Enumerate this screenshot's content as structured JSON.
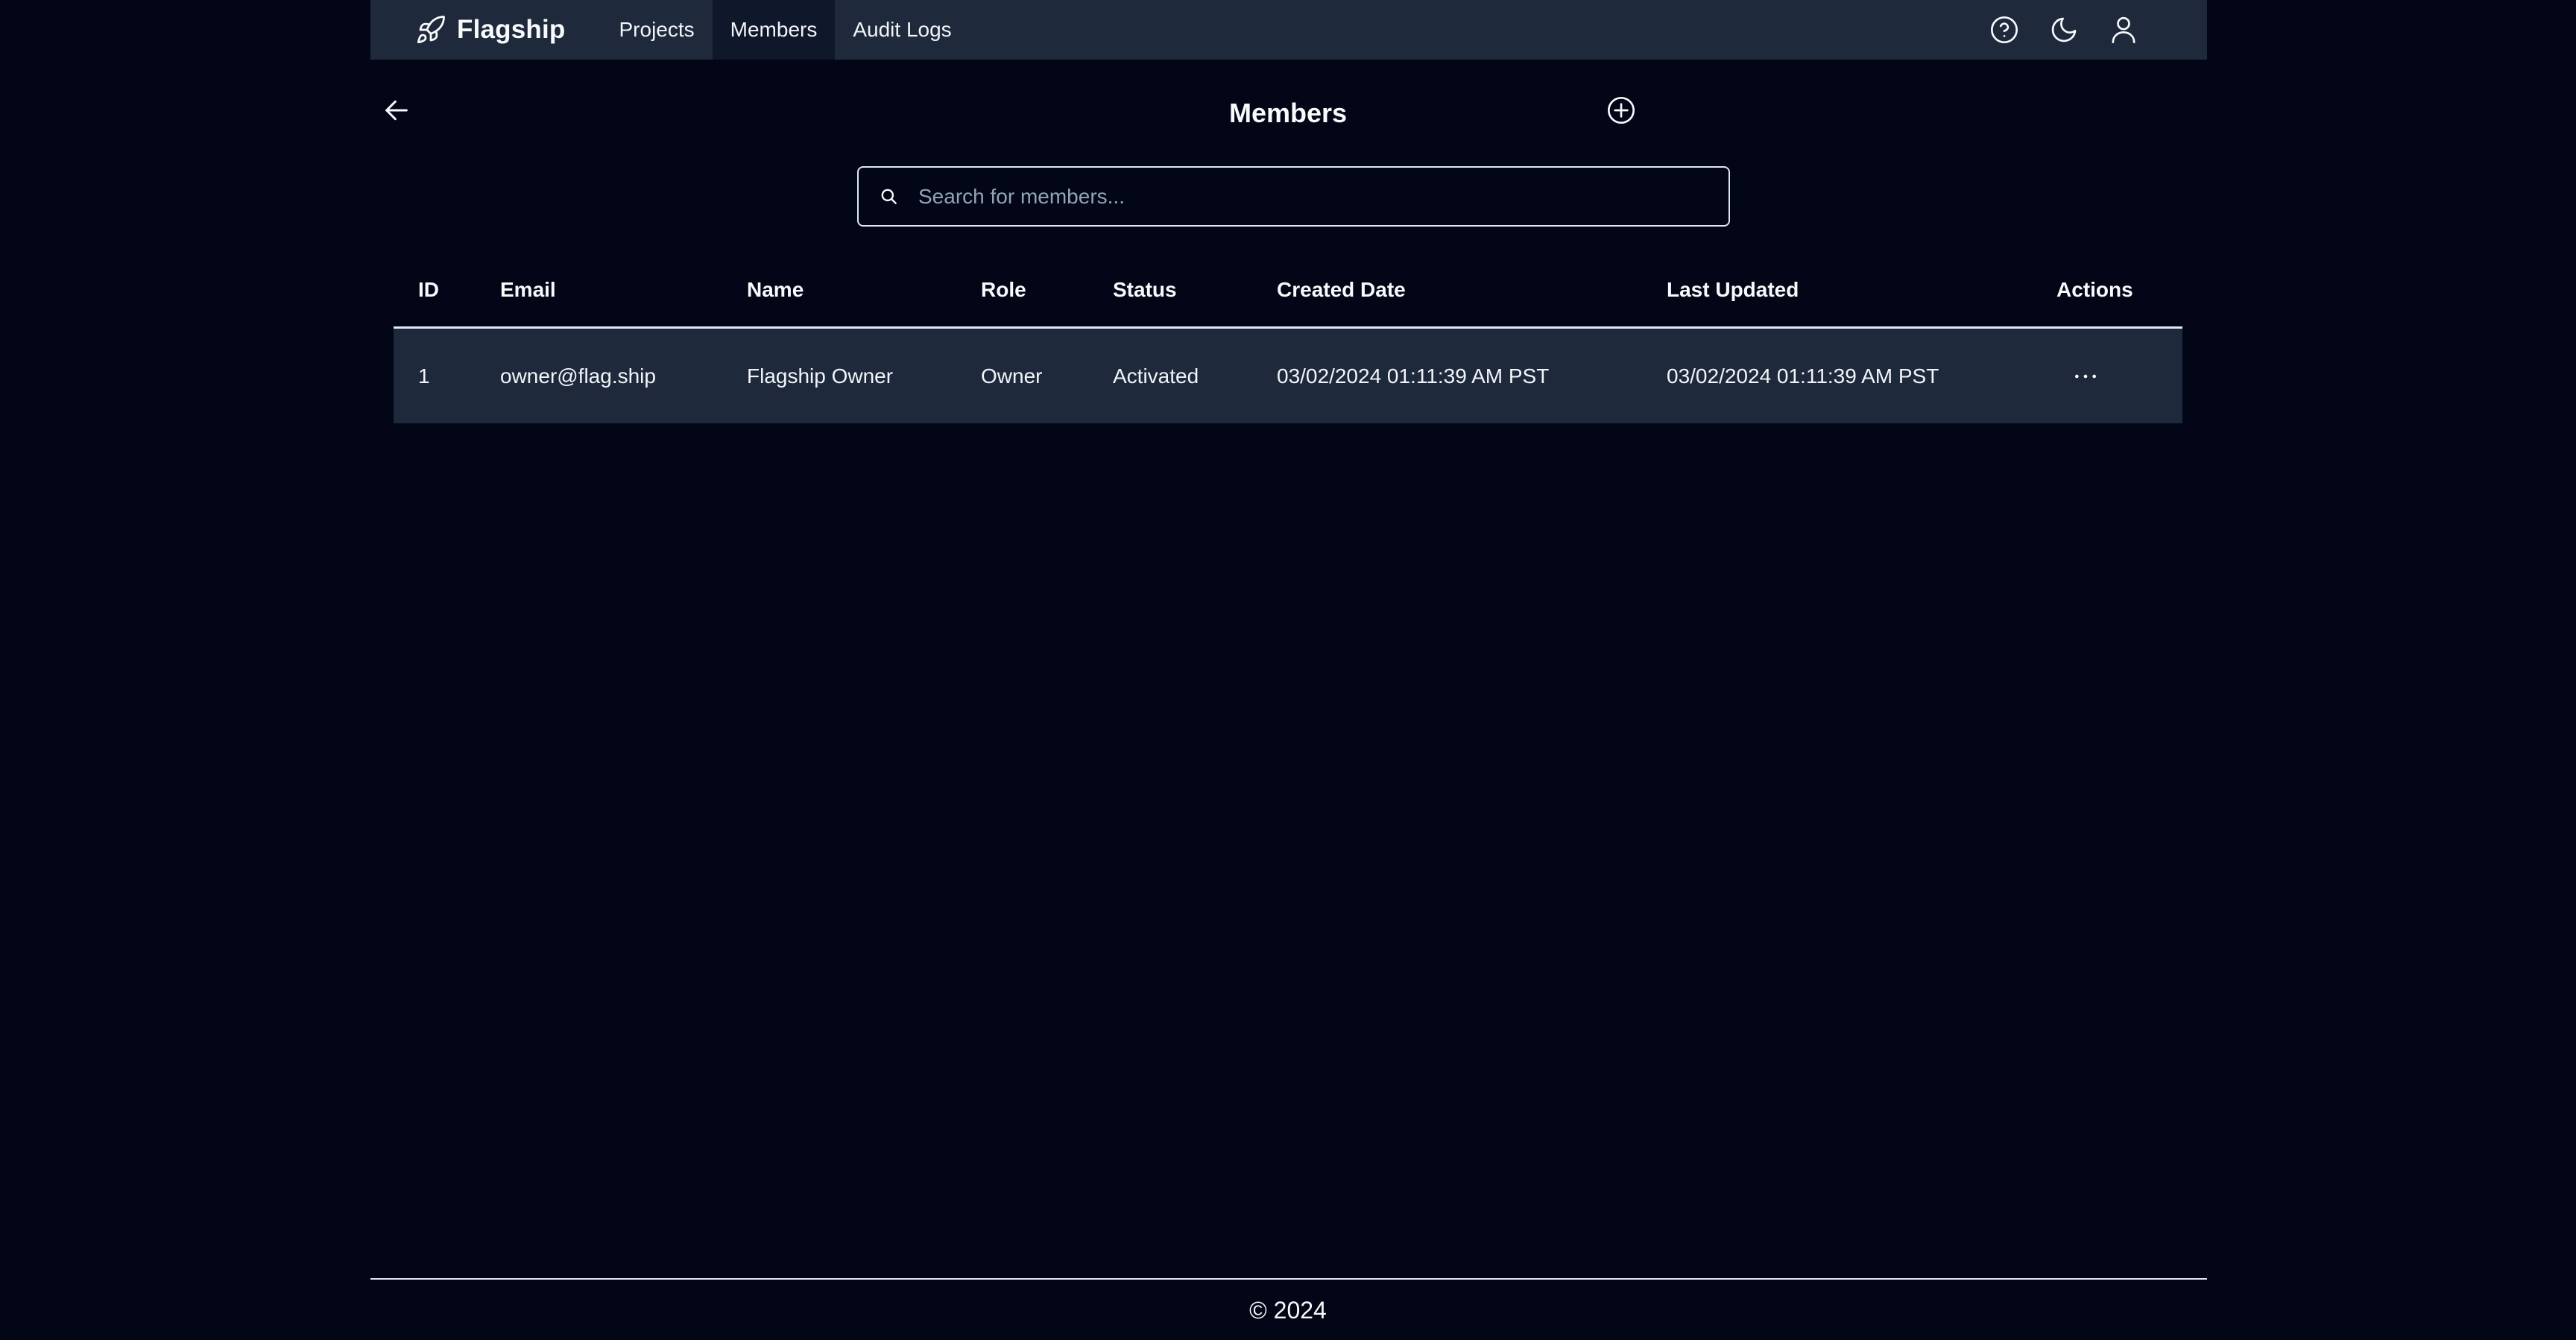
{
  "app": {
    "brand_name": "Flagship",
    "brand_icon": "rocket-icon"
  },
  "nav": {
    "links": [
      {
        "label": "Projects",
        "active": false
      },
      {
        "label": "Members",
        "active": true
      },
      {
        "label": "Audit Logs",
        "active": false
      }
    ],
    "right_icons": [
      "help-circle-icon",
      "moon-icon",
      "user-icon"
    ]
  },
  "page": {
    "title": "Members",
    "back_icon": "arrow-left-icon",
    "add_icon": "plus-circle-icon"
  },
  "search": {
    "placeholder": "Search for members...",
    "value": ""
  },
  "table": {
    "columns": [
      "ID",
      "Email",
      "Name",
      "Role",
      "Status",
      "Created Date",
      "Last Updated",
      "Actions"
    ],
    "rows": [
      {
        "id": "1",
        "email": "owner@flag.ship",
        "name": "Flagship Owner",
        "role": "Owner",
        "status": "Activated",
        "created": "03/02/2024 01:11:39 AM PST",
        "updated": "03/02/2024 01:11:39 AM PST",
        "actions_icon": "more-horizontal-icon"
      }
    ]
  },
  "footer": {
    "text": "© 2024"
  },
  "colors": {
    "background": "#020617",
    "surface": "#1e293b",
    "active_nav": "#0f172a",
    "text": "#f8fafc",
    "border": "#e2e8f0"
  }
}
